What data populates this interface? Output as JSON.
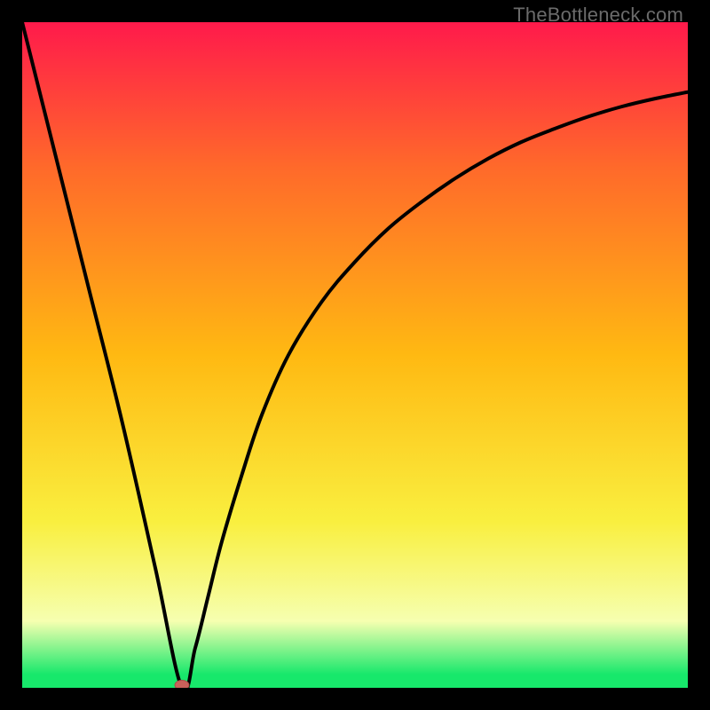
{
  "watermark": "TheBottleneck.com",
  "colors": {
    "bg_black": "#000000",
    "curve": "#000000",
    "marker_fill": "#c9615a",
    "marker_stroke": "#a84d47",
    "grad_top": "#ff1a4b",
    "grad_upper": "#ff6a2a",
    "grad_mid": "#ffb912",
    "grad_lower": "#f9ef3f",
    "grad_pale": "#f6ffb0",
    "grad_green": "#17e86b"
  },
  "chart_data": {
    "type": "line",
    "title": "",
    "xlabel": "",
    "ylabel": "",
    "xlim": [
      0,
      100
    ],
    "ylim": [
      0,
      100
    ],
    "notes": "Gradient background encodes bottleneck severity (red high, green low). Black curve shows bottleneck % vs component balance; minimum ≈0 at x≈24 marked by small pill.",
    "series": [
      {
        "name": "bottleneck-curve",
        "x": [
          0,
          5,
          10,
          15,
          20,
          24,
          26,
          28,
          30,
          33,
          36,
          40,
          45,
          50,
          55,
          60,
          65,
          70,
          75,
          80,
          85,
          90,
          95,
          100
        ],
        "values": [
          100,
          80,
          60,
          40,
          18,
          0,
          6,
          14,
          22,
          32,
          41,
          50,
          58,
          64,
          69,
          73,
          76.5,
          79.5,
          82,
          84,
          85.8,
          87.3,
          88.5,
          89.5
        ]
      }
    ],
    "marker": {
      "x": 24,
      "y": 0
    }
  }
}
